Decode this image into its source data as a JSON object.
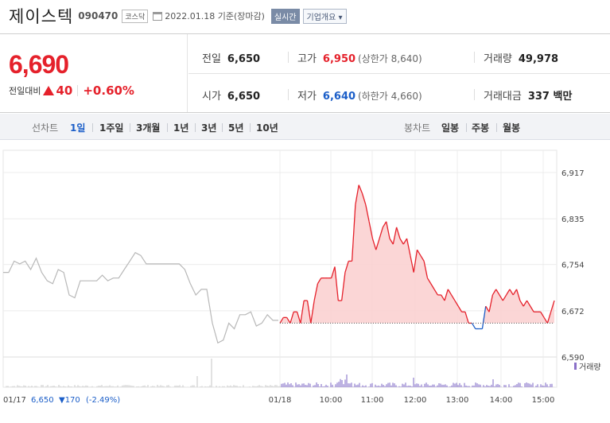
{
  "header": {
    "stock_name": "제이스텍",
    "stock_code": "090470",
    "market_badge": "코스닥",
    "date_text": "2022.01.18 기준(장마감)",
    "realtime_button": "실시간",
    "company_info_button": "기업개요 ▾"
  },
  "summary": {
    "price": "6,690",
    "change_label": "전일대비",
    "change_amount": "40",
    "change_percent": "+0.60%",
    "prev_close": {
      "label": "전일",
      "value": "6,650"
    },
    "high": {
      "label": "고가",
      "value": "6,950",
      "sub": "(상한가 8,640)"
    },
    "volume": {
      "label": "거래량",
      "value": "49,978"
    },
    "open": {
      "label": "시가",
      "value": "6,650"
    },
    "low": {
      "label": "저가",
      "value": "6,640",
      "sub": "(하한가 4,660)"
    },
    "amount": {
      "label": "거래대금",
      "value": "337 백만"
    }
  },
  "tabs": {
    "line_chart_label": "선차트",
    "periods": [
      "1일",
      "1주일",
      "3개월",
      "1년",
      "3년",
      "5년",
      "10년"
    ],
    "candle_label": "봉차트",
    "candles": [
      "일봉",
      "주봉",
      "월봉"
    ]
  },
  "colors": {
    "up": "#e5212b",
    "down": "#1b5ec8",
    "prev_line": "#b8b8b8"
  },
  "chart_data": {
    "type": "line",
    "y_ticks": [
      "6,917",
      "6,835",
      "6,754",
      "6,672",
      "6,590"
    ],
    "ylim": [
      6590,
      6917
    ],
    "baseline": 6650,
    "volume_legend": "거래량",
    "x_ticks": [
      "01/18",
      "10:00",
      "11:00",
      "12:00",
      "13:00",
      "14:00",
      "15:00"
    ],
    "prev_day_info": {
      "date": "01/17",
      "price": "6,650",
      "change": "▼170",
      "percent": "(-2.49%)"
    },
    "prev_day_series": [
      6740,
      6740,
      6760,
      6755,
      6760,
      6745,
      6765,
      6740,
      6725,
      6720,
      6745,
      6740,
      6700,
      6695,
      6725,
      6725,
      6725,
      6725,
      6735,
      6725,
      6730,
      6730,
      6745,
      6760,
      6775,
      6770,
      6755,
      6755,
      6755,
      6755,
      6755,
      6755,
      6755,
      6745,
      6720,
      6700,
      6710,
      6710,
      6650,
      6615,
      6620,
      6650,
      6640,
      6665,
      6665,
      6670,
      6645,
      6650,
      6665,
      6655,
      6655
    ],
    "today_series": [
      6650,
      6660,
      6660,
      6650,
      6670,
      6670,
      6650,
      6690,
      6690,
      6650,
      6690,
      6720,
      6730,
      6730,
      6730,
      6730,
      6750,
      6690,
      6690,
      6740,
      6760,
      6760,
      6860,
      6895,
      6880,
      6860,
      6830,
      6800,
      6780,
      6800,
      6820,
      6830,
      6800,
      6790,
      6820,
      6800,
      6790,
      6800,
      6770,
      6740,
      6780,
      6770,
      6760,
      6730,
      6720,
      6710,
      6700,
      6700,
      6690,
      6710,
      6700,
      6690,
      6680,
      6670,
      6670,
      6650,
      6650,
      6640,
      6640,
      6640,
      6680,
      6670,
      6700,
      6710,
      6700,
      6690,
      6700,
      6710,
      6700,
      6710,
      6690,
      6680,
      6690,
      6680,
      6670,
      6670,
      6670,
      6660,
      6650,
      6670,
      6690
    ]
  }
}
